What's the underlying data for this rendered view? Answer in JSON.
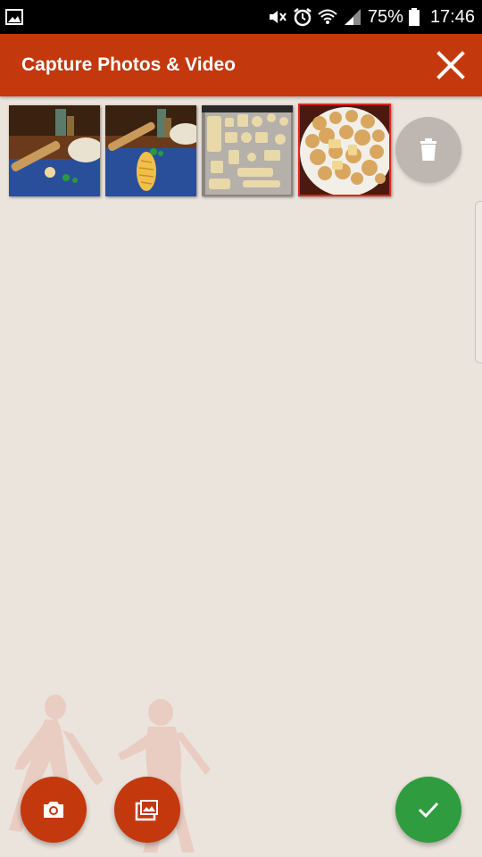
{
  "status_bar": {
    "battery": "75%",
    "time": "17:46",
    "icons": [
      "gallery-notification-icon",
      "mute-icon",
      "alarm-icon",
      "wifi-icon",
      "signal-icon",
      "battery-icon"
    ]
  },
  "app_bar": {
    "title": "Capture Photos & Video",
    "close_icon": "close-icon"
  },
  "thumbnails": [
    {
      "name": "photo-dough-rolling",
      "selected": false
    },
    {
      "name": "photo-dough-shaped",
      "selected": false
    },
    {
      "name": "photo-cutout-cookies-tray",
      "selected": false
    },
    {
      "name": "photo-baked-cookies-plate",
      "selected": true
    }
  ],
  "actions": {
    "delete_icon": "trash-icon",
    "camera_icon": "camera-icon",
    "gallery_icon": "gallery-icon",
    "confirm_icon": "check-icon"
  },
  "colors": {
    "primary": "#c4380e",
    "confirm": "#2e9c3f",
    "selection_border": "#e0231f",
    "background": "#ebe4dc"
  }
}
